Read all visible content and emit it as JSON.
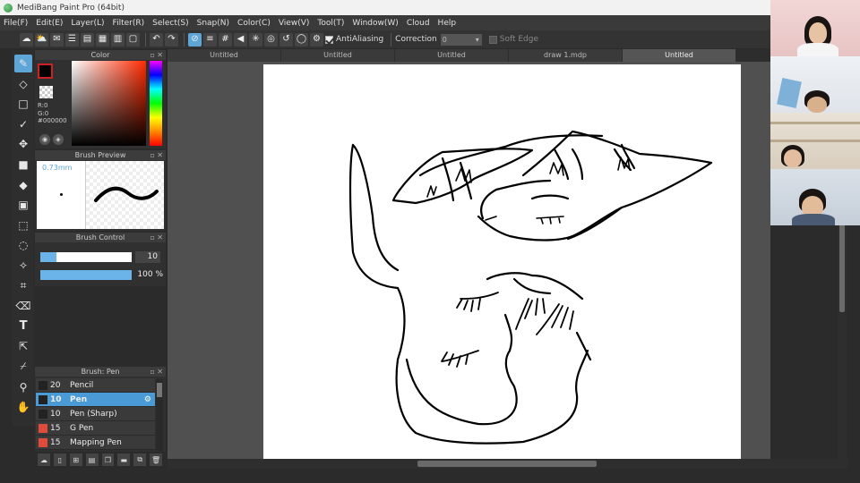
{
  "title": "MediBang Paint Pro (64bit)",
  "menu": [
    "File(F)",
    "Edit(E)",
    "Layer(L)",
    "Filter(R)",
    "Select(S)",
    "Snap(N)",
    "Color(C)",
    "View(V)",
    "Tool(T)",
    "Window(W)",
    "Cloud",
    "Help"
  ],
  "toolbar": {
    "antialiasing_label": "AntiAliasing",
    "correction_label": "Correction",
    "correction_value": "0",
    "soft_edge_label": "Soft Edge"
  },
  "color_panel": {
    "title": "Color",
    "r": "R:0",
    "g": "G:0",
    "hex": "#000000"
  },
  "brush_preview": {
    "title": "Brush Preview",
    "size": "0.73mm"
  },
  "brush_control": {
    "title": "Brush Control",
    "size_value": "10",
    "size_fraction": 0.18,
    "opacity_value": "100 %",
    "opacity_fraction": 1.0
  },
  "brush_list": {
    "title": "Brush: Pen",
    "items": [
      {
        "num": "20",
        "name": "Pencil",
        "chip": "dark",
        "active": false
      },
      {
        "num": "10",
        "name": "Pen",
        "chip": "dark",
        "active": true
      },
      {
        "num": "10",
        "name": "Pen (Sharp)",
        "chip": "dark",
        "active": false
      },
      {
        "num": "15",
        "name": "G Pen",
        "chip": "red",
        "active": false
      },
      {
        "num": "15",
        "name": "Mapping Pen",
        "chip": "red",
        "active": false
      }
    ]
  },
  "tabs": [
    {
      "label": "Untitled",
      "active": false
    },
    {
      "label": "Untitled",
      "active": false
    },
    {
      "label": "Untitled",
      "active": false
    },
    {
      "label": "draw 1.mdp",
      "active": false
    },
    {
      "label": "Untitled",
      "active": true
    }
  ],
  "colors": {
    "accent": "#5ea5d8",
    "primary_color": "#000000",
    "red_chip": "#e04a3a"
  },
  "tools": [
    "brush-icon",
    "eraser-icon",
    "dot-icon",
    "check-icon",
    "move-icon",
    "rect-fill-icon",
    "bucket-icon",
    "gradient-icon",
    "select-rect-icon",
    "select-lasso-icon",
    "magic-wand-icon",
    "select-pen-icon",
    "select-eraser-icon",
    "text-icon",
    "operation-icon",
    "eyedropper-icon",
    "dropper-icon",
    "hand-icon"
  ]
}
